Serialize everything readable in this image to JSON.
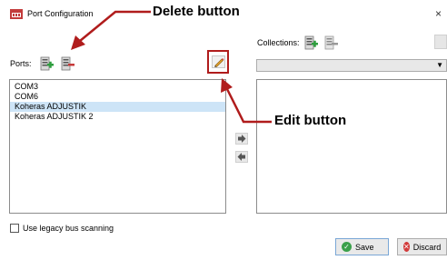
{
  "window": {
    "title": "Port Configuration",
    "close_label": "×"
  },
  "ports": {
    "label": "Ports:",
    "items": [
      "COM3",
      "COM6",
      "Koheras ADJUSTIK",
      "Koheras ADJUSTIK 2"
    ],
    "selected_index": 2,
    "add_icon": "add-port-icon",
    "delete_icon": "delete-port-icon",
    "edit_icon": "pencil-icon"
  },
  "collections": {
    "label": "Collections:",
    "selected_value": "",
    "dropdown_icon": "chevron-down-icon"
  },
  "options": {
    "legacy_label": "Use legacy bus scanning",
    "legacy_checked": false
  },
  "footer": {
    "save_label": "Save",
    "discard_label": "Discard"
  },
  "annotations": {
    "delete_label": "Delete button",
    "edit_label": "Edit button",
    "color": "#b01c1c"
  },
  "colors": {
    "selection": "#cde4f7",
    "add_green": "#2f9e3f",
    "delete_red": "#c73a3a",
    "save_green": "#3aa04a",
    "discard_red": "#d23b3b"
  }
}
